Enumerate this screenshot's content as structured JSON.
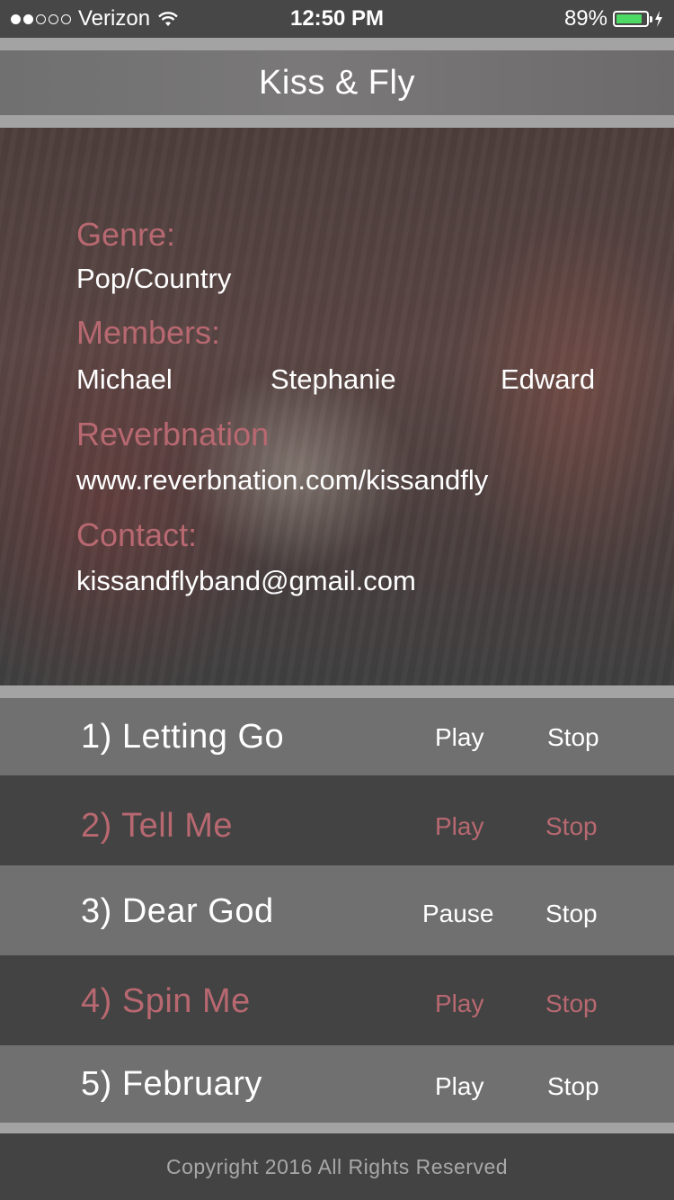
{
  "status_bar": {
    "carrier": "Verizon",
    "time": "12:50 PM",
    "battery_percent": "89%",
    "battery_level": 0.89,
    "signal_bars": 2,
    "signal_total": 5
  },
  "nav": {
    "title": "Kiss & Fly"
  },
  "info": {
    "genre_label": "Genre:",
    "genre_value": "Pop/Country",
    "members_label": "Members:",
    "members": [
      "Michael",
      "Stephanie",
      "Edward"
    ],
    "reverbnation_label": "Reverbnation",
    "reverbnation_value": "www.reverbnation.com/kissandfly",
    "contact_label": "Contact:",
    "contact_value": "kissandflyband@gmail.com"
  },
  "songs": [
    {
      "title": "1) Letting Go",
      "primary": "Play",
      "stop": "Stop"
    },
    {
      "title": "2) Tell Me",
      "primary": "Play",
      "stop": "Stop"
    },
    {
      "title": "3) Dear God",
      "primary": "Pause",
      "stop": "Stop"
    },
    {
      "title": "4) Spin Me",
      "primary": "Play",
      "stop": "Stop"
    },
    {
      "title": "5) February",
      "primary": "Play",
      "stop": "Stop"
    }
  ],
  "footer": {
    "copyright": "Copyright 2016 All Rights Reserved"
  },
  "colors": {
    "accent": "#b86870",
    "battery": "#4cd964"
  }
}
